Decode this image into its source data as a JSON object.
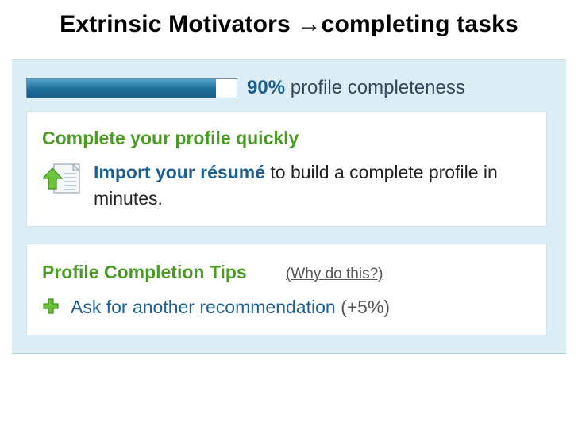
{
  "slide": {
    "title_part1": "Extrinsic Motivators",
    "title_arrow": "→",
    "title_part2": "completing tasks"
  },
  "progress": {
    "fraction": 0.9,
    "percent_label": "90%",
    "label": "profile completeness"
  },
  "card_quick": {
    "heading": "Complete your profile quickly",
    "icon": "import-document-icon",
    "link_text": "Import your résumé",
    "body_text": "to build a complete profile in minutes."
  },
  "card_tips": {
    "heading": "Profile Completion Tips",
    "why_link": "(Why do this?)",
    "icon": "plus-icon",
    "tip_text": "Ask for another recommendation",
    "tip_bonus": "(+5%)"
  },
  "colors": {
    "heading_green": "#4a9a24",
    "link_blue": "#1d5f93",
    "panel_bg": "#dcedf6",
    "progress_blue": "#1f6f9c"
  }
}
